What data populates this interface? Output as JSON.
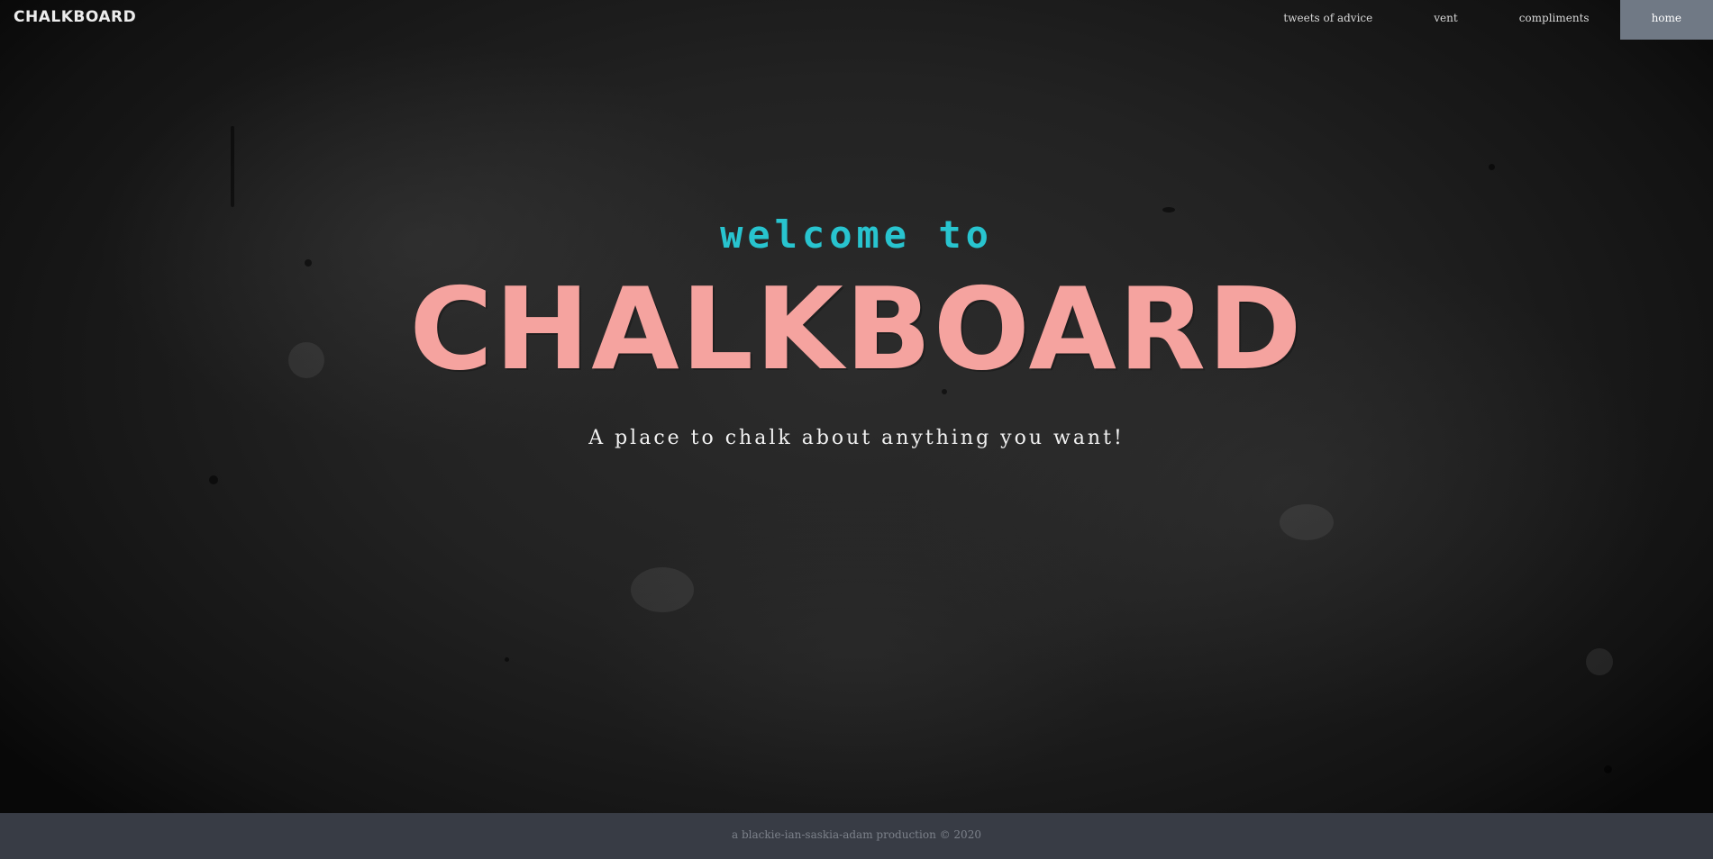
{
  "nav": {
    "brand": "CHALKBOARD",
    "links": [
      {
        "label": "tweets of advice"
      },
      {
        "label": "vent"
      },
      {
        "label": "compliments"
      },
      {
        "label": "home"
      }
    ]
  },
  "hero": {
    "welcome": "welcome to",
    "title": "CHALKBOARD",
    "tagline": "A place to chalk about anything you want!"
  },
  "footer": {
    "text": "a blackie-ian-saskia-adam production © 2020"
  },
  "colors": {
    "welcome": "#28c4cf",
    "title": "#f5a39f",
    "nav_active_bg": "#707985",
    "footer_bg": "#383c45"
  }
}
